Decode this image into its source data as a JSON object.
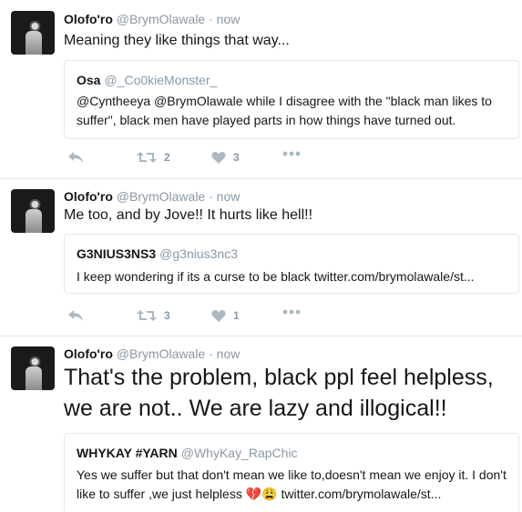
{
  "tweets": [
    {
      "name": "Olofo'ro",
      "handle": "@BrymOlawale",
      "dot": "·",
      "time": "now",
      "text": "Meaning they like things that way...",
      "quote": {
        "name": "Osa",
        "handle": "@_Co0kieMonster_",
        "text": "@Cyntheeya @BrymOlawale while I disagree with the \"black man likes to suffer\", black men have played parts in how things have turned out."
      },
      "retweets": "2",
      "likes": "3"
    },
    {
      "name": "Olofo'ro",
      "handle": "@BrymOlawale",
      "dot": "·",
      "time": "now",
      "text": "Me too, and by Jove!! It hurts like hell!!",
      "quote": {
        "name": "G3NIUS3NS3",
        "handle": "@g3nius3nc3",
        "text": "I keep wondering if its a curse to be black twitter.com/brymolawale/st..."
      },
      "retweets": "3",
      "likes": "1"
    },
    {
      "name": "Olofo'ro",
      "handle": "@BrymOlawale",
      "dot": "·",
      "time": "now",
      "text": "That's the problem, black ppl feel helpless, we are not.. We are lazy and illogical!!",
      "quote": {
        "name": "WHYKAY #YARN",
        "handle": "@WhyKay_RapChic",
        "text": "Yes we suffer but that don't mean we like to,doesn't mean we enjoy it. I don't like to suffer ,we just helpless",
        "emoji": "💔😩",
        "link": "twitter.com/brymolawale/st..."
      }
    }
  ],
  "icons": {
    "reply": "reply-icon",
    "retweet": "retweet-icon",
    "like": "heart-icon",
    "more": "more-icon"
  },
  "colors": {
    "text": "#14171a",
    "muted": "#8899a6",
    "action": "#aab8c2",
    "border": "#e1e8ed"
  }
}
